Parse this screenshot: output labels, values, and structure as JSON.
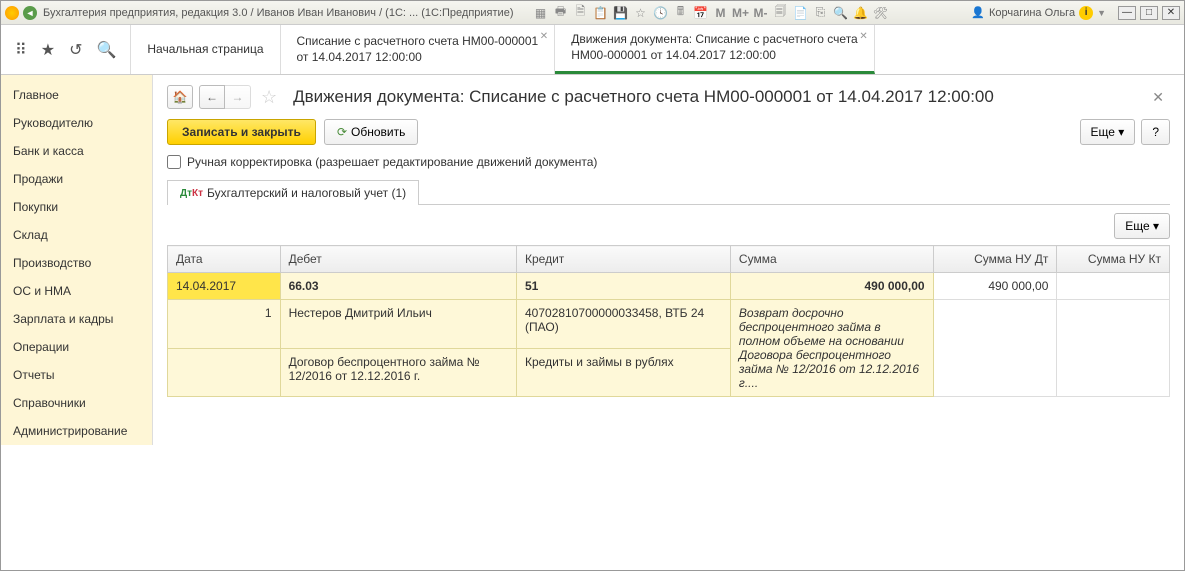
{
  "titleBar": {
    "appTitle": "Бухгалтерия предприятия, редакция 3.0 / Иванов Иван Иванович / (1С: ... (1С:Предприятие)",
    "mLabels": [
      "M",
      "M+",
      "M-"
    ],
    "userName": "Корчагина Ольга"
  },
  "navTabs": [
    {
      "line1": "Начальная страница",
      "line2": ""
    },
    {
      "line1": "Списание с расчетного счета НМ00-000001",
      "line2": "от 14.04.2017 12:00:00"
    },
    {
      "line1": "Движения документа: Списание с расчетного счета",
      "line2": "НМ00-000001 от 14.04.2017 12:00:00"
    }
  ],
  "sidebar": {
    "items": [
      "Главное",
      "Руководителю",
      "Банк и касса",
      "Продажи",
      "Покупки",
      "Склад",
      "Производство",
      "ОС и НМА",
      "Зарплата и кадры",
      "Операции",
      "Отчеты",
      "Справочники",
      "Администрирование"
    ]
  },
  "document": {
    "title": "Движения документа: Списание с расчетного счета НМ00-000001 от 14.04.2017 12:00:00",
    "saveCloseLabel": "Записать и закрыть",
    "refreshLabel": "Обновить",
    "moreLabel": "Еще",
    "helpLabel": "?",
    "checkboxLabel": "Ручная корректировка (разрешает редактирование движений документа)",
    "innerTabLabel": "Бухгалтерский и налоговый учет (1)"
  },
  "table": {
    "headers": [
      "Дата",
      "Дебет",
      "Кредит",
      "Сумма",
      "Сумма НУ Дт",
      "Сумма НУ Кт"
    ],
    "row1": {
      "date": "14.04.2017",
      "debit": "66.03",
      "credit": "51",
      "sum": "490 000,00",
      "sumNuDt": "490 000,00",
      "sumNuKt": ""
    },
    "row2": {
      "num": "1",
      "debit": "Нестеров Дмитрий Ильич",
      "credit": "40702810700000033458, ВТБ 24 (ПАО)",
      "sumText": "Возврат досрочно беспроцентного займа в полном объеме на основании Договора беспроцентного займа № 12/2016 от 12.12.2016 г...."
    },
    "row3": {
      "debit": "Договор беспроцентного займа № 12/2016 от 12.12.2016 г.",
      "credit": "Кредиты и займы в рублях"
    }
  }
}
